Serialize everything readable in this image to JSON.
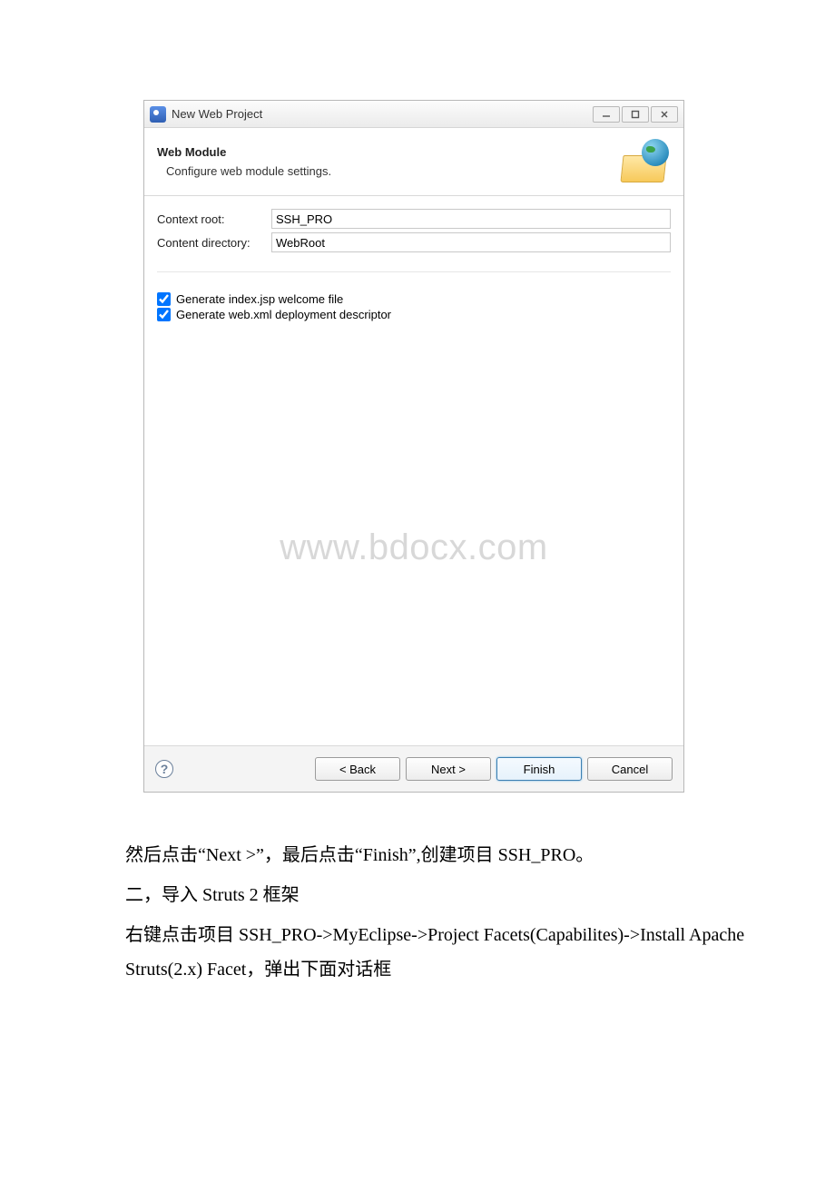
{
  "dialog": {
    "title": "New Web Project",
    "header_title": "Web Module",
    "header_sub": "Configure web module settings.",
    "fields": {
      "context_root_label": "Context root:",
      "context_root_value": "SSH_PRO",
      "content_dir_label": "Content directory:",
      "content_dir_value": "WebRoot"
    },
    "checks": {
      "gen_index_label": "Generate index.jsp welcome file",
      "gen_index_checked": true,
      "gen_webxml_label": "Generate web.xml deployment descriptor",
      "gen_webxml_checked": true
    },
    "watermark": "www.bdocx.com",
    "buttons": {
      "back": "< Back",
      "next": "Next >",
      "finish": "Finish",
      "cancel": "Cancel"
    }
  },
  "prose": {
    "p1": "然后点击“Next >”，最后点击“Finish”,创建项目 SSH_PRO。",
    "h2": "二，导入 Struts 2 框架",
    "p2": "右键点击项目 SSH_PRO->MyEclipse->Project Facets(Capabilites)->Install Apache Struts(2.x) Facet，弹出下面对话框"
  }
}
